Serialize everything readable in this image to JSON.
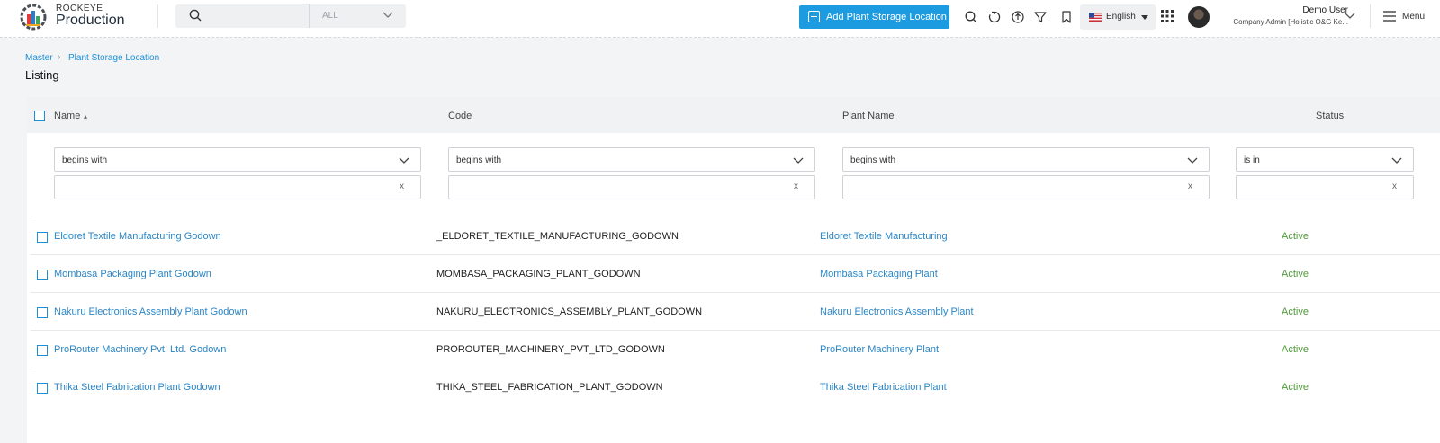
{
  "app": {
    "brand_small": "ROCKEYE",
    "brand_big": "Production"
  },
  "search": {
    "placeholder": "",
    "scope": "ALL"
  },
  "header": {
    "add_button": "Add Plant Storage Location",
    "language": "English",
    "user_name": "Demo User",
    "user_role": "Company Admin [Holistic O&G Ke...",
    "menu_label": "Menu",
    "icons": [
      "search-icon",
      "refresh-icon",
      "upload-icon",
      "filter-icon",
      "bookmark-icon",
      "apps-grid-icon",
      "menu-icon"
    ]
  },
  "breadcrumb": {
    "items": [
      "Master",
      "Plant Storage Location"
    ]
  },
  "page": {
    "title": "Listing"
  },
  "table": {
    "columns": [
      "Name",
      "Code",
      "Plant Name",
      "Status"
    ],
    "filters": [
      {
        "operator": "begins with",
        "value": "",
        "clear": "x"
      },
      {
        "operator": "begins with",
        "value": "",
        "clear": "x"
      },
      {
        "operator": "begins with",
        "value": "",
        "clear": "x"
      },
      {
        "operator": "is in",
        "value": "",
        "clear": "x"
      }
    ],
    "rows": [
      {
        "name": "Eldoret Textile Manufacturing Godown",
        "code": "_ELDORET_TEXTILE_MANUFACTURING_GODOWN",
        "plant": "Eldoret Textile Manufacturing",
        "status": "Active"
      },
      {
        "name": "Mombasa Packaging Plant Godown",
        "code": "MOMBASA_PACKAGING_PLANT_GODOWN",
        "plant": "Mombasa Packaging Plant",
        "status": "Active"
      },
      {
        "name": "Nakuru Electronics Assembly Plant Godown",
        "code": "NAKURU_ELECTRONICS_ASSEMBLY_PLANT_GODOWN",
        "plant": "Nakuru Electronics Assembly Plant",
        "status": "Active"
      },
      {
        "name": "ProRouter Machinery Pvt. Ltd. Godown",
        "code": "PROROUTER_MACHINERY_PVT_LTD_GODOWN",
        "plant": "ProRouter Machinery Plant",
        "status": "Active"
      },
      {
        "name": "Thika Steel Fabrication Plant Godown",
        "code": "THIKA_STEEL_FABRICATION_PLANT_GODOWN",
        "plant": "Thika Steel Fabrication Plant",
        "status": "Active"
      }
    ]
  },
  "colors": {
    "accent": "#1d9be0",
    "link": "#2b86c5",
    "status_active": "#4e9a3a"
  }
}
